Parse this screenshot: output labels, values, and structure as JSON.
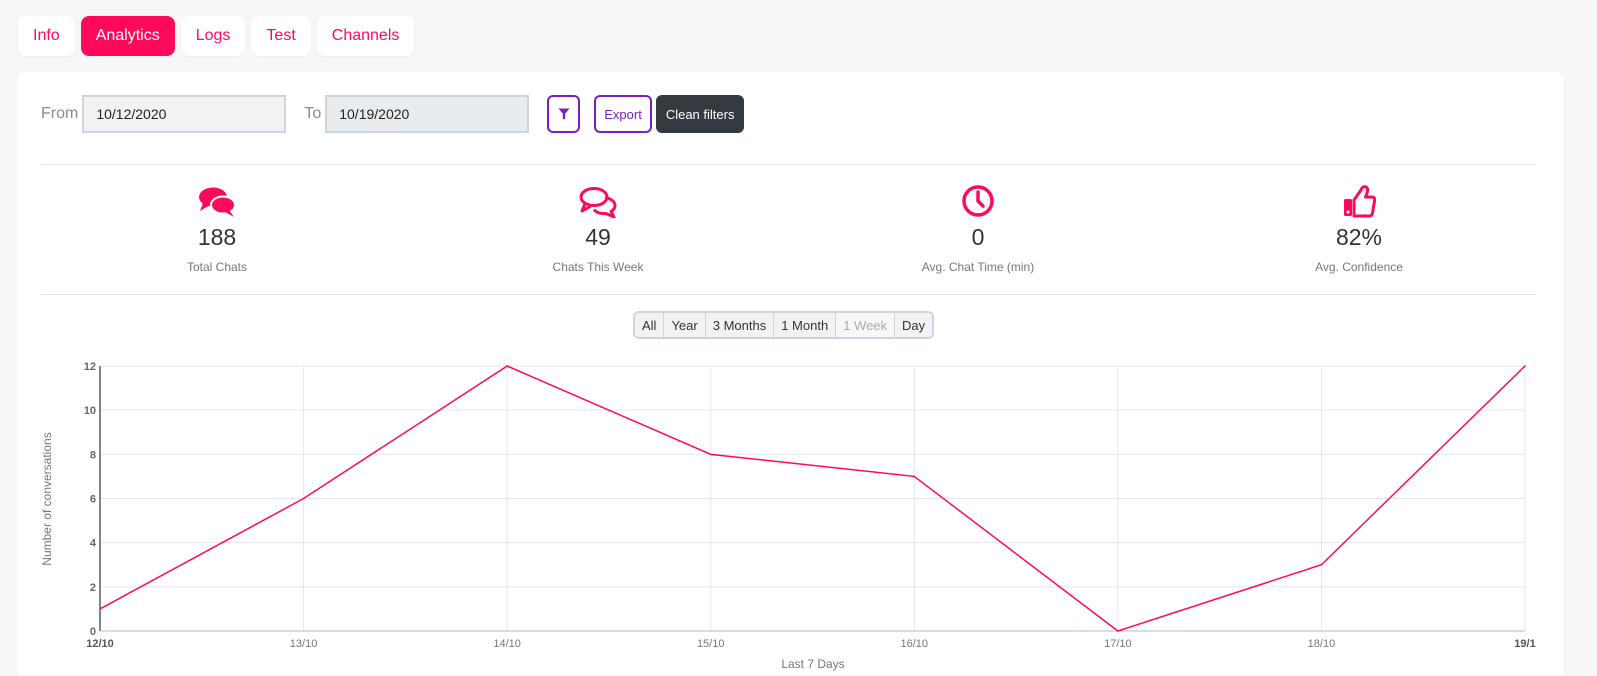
{
  "tabs": [
    {
      "label": "Info",
      "active": false
    },
    {
      "label": "Analytics",
      "active": true
    },
    {
      "label": "Logs",
      "active": false
    },
    {
      "label": "Test",
      "active": false
    },
    {
      "label": "Channels",
      "active": false
    }
  ],
  "filters": {
    "from_label": "From",
    "from_value": "10/12/2020",
    "to_label": "To",
    "to_value": "10/19/2020",
    "export_label": "Export",
    "clean_label": "Clean filters"
  },
  "stats": [
    {
      "icon": "comments-icon",
      "value": "188",
      "label": "Total Chats"
    },
    {
      "icon": "comments-outline-icon",
      "value": "49",
      "label": "Chats This Week"
    },
    {
      "icon": "clock-icon",
      "value": "0",
      "label": "Avg. Chat Time (min)"
    },
    {
      "icon": "thumbs-up-icon",
      "value": "82%",
      "label": "Avg. Confidence"
    }
  ],
  "ranges": [
    {
      "label": "All",
      "disabled": false
    },
    {
      "label": "Year",
      "disabled": false
    },
    {
      "label": "3 Months",
      "disabled": false
    },
    {
      "label": "1 Month",
      "disabled": false
    },
    {
      "label": "1 Week",
      "disabled": true
    },
    {
      "label": "Day",
      "disabled": false
    }
  ],
  "colors": {
    "accent": "#ff0a5a",
    "purple": "#7a1fbf",
    "dark": "#343a40"
  },
  "chart_data": {
    "type": "line",
    "categories": [
      "12/10",
      "13/10",
      "14/10",
      "15/10",
      "16/10",
      "17/10",
      "18/10",
      "19/1"
    ],
    "series": [
      {
        "values": [
          1,
          6,
          12,
          8,
          7,
          0,
          3,
          12
        ]
      }
    ],
    "xlabel": "Last 7 Days",
    "ylabel": "Number of conversations",
    "ylim": [
      0,
      12
    ],
    "yticks": [
      0,
      2,
      4,
      6,
      8,
      10,
      12
    ],
    "grid": true
  }
}
